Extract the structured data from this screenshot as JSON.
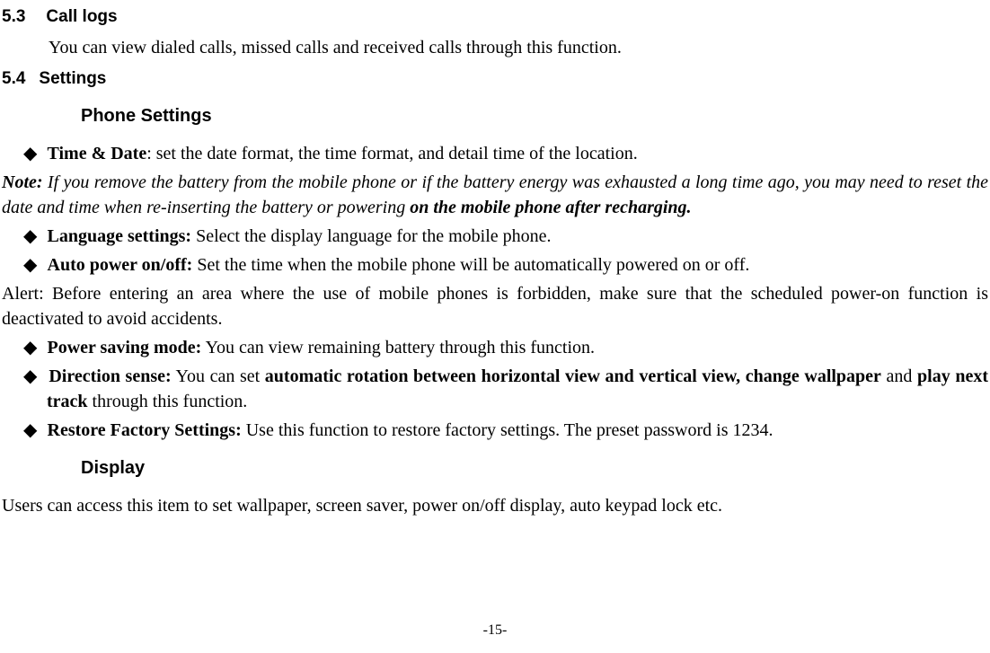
{
  "section53": {
    "num": "5.3",
    "title": "Call logs",
    "body": "You can view dialed calls, missed calls and received calls through this function."
  },
  "section54": {
    "num": "5.4",
    "title": "Settings"
  },
  "phoneSettings": {
    "heading": "Phone Settings",
    "bullets": {
      "timeDate": {
        "label": "Time & Date",
        "text": ": set the date format, the time format, and detail time of the location."
      },
      "note": {
        "prefix": "Note:",
        "body1": " If you remove the battery from the mobile phone or if the battery energy was exhausted a long time ago, you may need to reset the date and time when re-inserting the battery or powering ",
        "body2": "on the mobile phone after recharging."
      },
      "language": {
        "label": "Language settings:",
        "text": " Select the display language for the mobile phone."
      },
      "autoPower": {
        "label": "Auto power on/off:",
        "text": " Set the time when the mobile phone will be automatically powered on or off."
      },
      "alert": "Alert: Before entering an area where the use of mobile phones is forbidden, make sure that the scheduled power-on function is deactivated to avoid accidents.",
      "powerSaving": {
        "label": "Power saving mode:",
        "text": " You can view remaining battery through this function."
      },
      "direction": {
        "label": "Direction sense:",
        "text1": " You can set ",
        "bold1": "automatic rotation between horizontal view and vertical view, change wallpaper",
        "text2": " and ",
        "bold2": "play next track",
        "text3": " through this function."
      },
      "restore": {
        "label": "Restore Factory Settings:",
        "text": " Use this function to restore factory settings. The preset password is 1234."
      }
    }
  },
  "display": {
    "heading": "Display",
    "body": "Users can access this item to set wallpaper, screen saver, power on/off display, auto keypad lock etc."
  },
  "pageNumber": "-15-"
}
